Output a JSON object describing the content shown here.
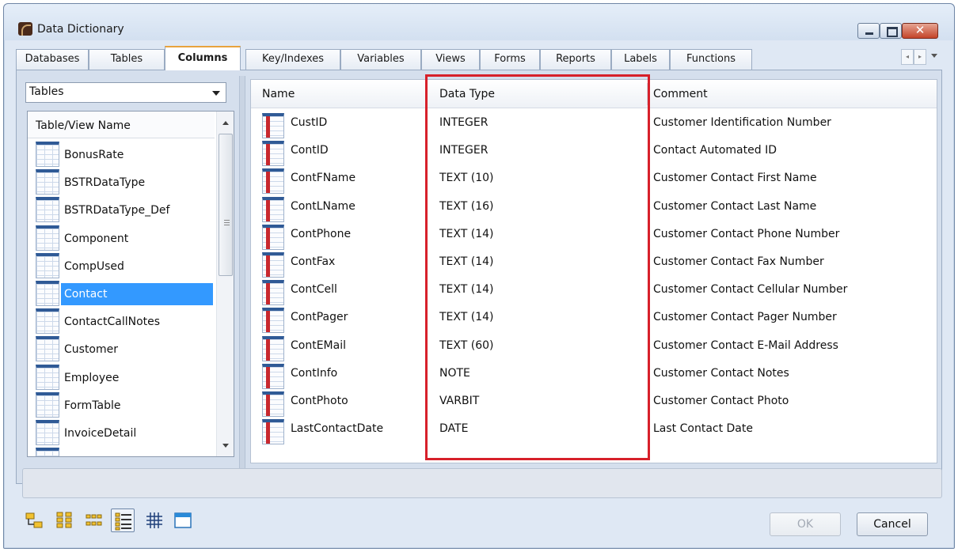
{
  "window": {
    "title": "Data Dictionary",
    "close_glyph": "✕"
  },
  "tabs": [
    {
      "label": "Databases",
      "active": false
    },
    {
      "label": "Tables",
      "active": false
    },
    {
      "label": "Columns",
      "active": true
    },
    {
      "label": "Key/Indexes",
      "active": false
    },
    {
      "label": "Variables",
      "active": false
    },
    {
      "label": "Views",
      "active": false
    },
    {
      "label": "Forms",
      "active": false
    },
    {
      "label": "Reports",
      "active": false
    },
    {
      "label": "Labels",
      "active": false
    },
    {
      "label": "Functions",
      "active": false
    }
  ],
  "left_pane": {
    "combo_value": "Tables",
    "list_header": "Table/View Name",
    "items": [
      {
        "label": "BonusRate"
      },
      {
        "label": "BSTRDataType"
      },
      {
        "label": "BSTRDataType_Def"
      },
      {
        "label": "Component"
      },
      {
        "label": "CompUsed"
      },
      {
        "label": "Contact",
        "selected": true
      },
      {
        "label": "ContactCallNotes"
      },
      {
        "label": "Customer"
      },
      {
        "label": "Employee"
      },
      {
        "label": "FormTable"
      },
      {
        "label": "InvoiceDetail"
      }
    ]
  },
  "grid": {
    "headers": {
      "name": "Name",
      "data_type": "Data Type",
      "comment": "Comment"
    },
    "rows": [
      {
        "name": "CustID",
        "data_type": "INTEGER",
        "comment": "Customer Identification Number"
      },
      {
        "name": "ContID",
        "data_type": "INTEGER",
        "comment": "Contact Automated ID"
      },
      {
        "name": "ContFName",
        "data_type": "TEXT (10)",
        "comment": "Customer Contact First Name"
      },
      {
        "name": "ContLName",
        "data_type": "TEXT (16)",
        "comment": "Customer Contact Last Name"
      },
      {
        "name": "ContPhone",
        "data_type": "TEXT (14)",
        "comment": "Customer Contact Phone Number"
      },
      {
        "name": "ContFax",
        "data_type": "TEXT (14)",
        "comment": "Customer Contact Fax Number"
      },
      {
        "name": "ContCell",
        "data_type": "TEXT (14)",
        "comment": "Customer Contact Cellular Number"
      },
      {
        "name": "ContPager",
        "data_type": "TEXT (14)",
        "comment": "Customer Contact Pager Number"
      },
      {
        "name": "ContEMail",
        "data_type": "TEXT (60)",
        "comment": "Customer Contact E-Mail Address"
      },
      {
        "name": "ContInfo",
        "data_type": "NOTE",
        "comment": "Customer Contact Notes"
      },
      {
        "name": "ContPhoto",
        "data_type": "VARBIT",
        "comment": "Customer Contact Photo"
      },
      {
        "name": "LastContactDate",
        "data_type": "DATE",
        "comment": "Last Contact Date"
      }
    ]
  },
  "toolbar": {
    "view_icons": [
      "tree-view-icon",
      "large-icons-view-icon",
      "small-icons-view-icon",
      "list-view-icon",
      "grid-view-icon",
      "window-view-icon"
    ],
    "pressed_icon": "list-view-icon"
  },
  "buttons": {
    "ok_label": "OK",
    "cancel_label": "Cancel"
  },
  "colors": {
    "highlight": "#d7202a",
    "selection": "#3399ff",
    "active_tab_accent": "#e8a33d"
  }
}
